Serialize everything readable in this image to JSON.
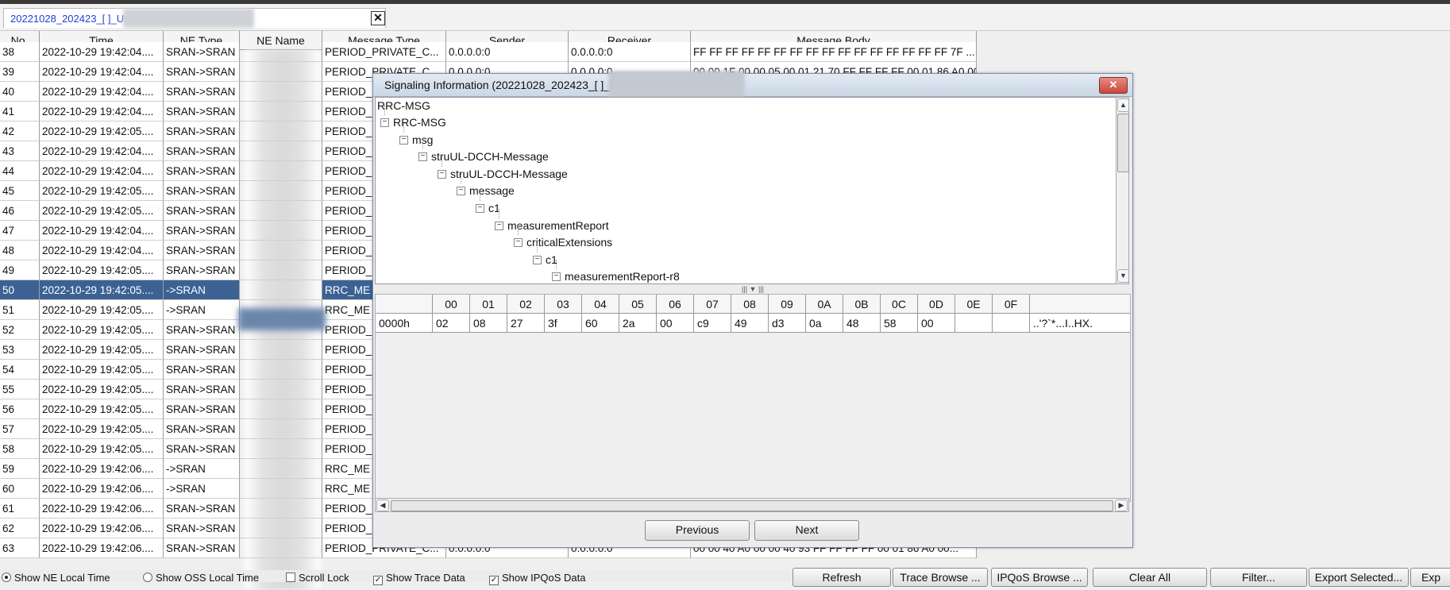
{
  "tab": {
    "title": "20221028_202423_[                          ]_User Trace ID=33333",
    "close_glyph": "✕"
  },
  "table": {
    "columns": [
      "No.",
      "Time",
      "NE Type",
      "NE Name",
      "Message Type",
      "Sender",
      "Receiver",
      "Message Body"
    ],
    "rows": [
      {
        "no": "38",
        "time": "2022-10-29 19:42:04....",
        "ne_type": "SRAN->SRAN",
        "msg": "PERIOD_PRIVATE_C...",
        "sender": "0.0.0.0:0",
        "receiver": "0.0.0.0:0",
        "body": "FF FF FF FF FF FF FF FF FF FF FF FF FF FF FF FF 7F ..."
      },
      {
        "no": "39",
        "time": "2022-10-29 19:42:04....",
        "ne_type": "SRAN->SRAN",
        "msg": "PERIOD_PRIVATE_C...",
        "sender": "0.0.0.0:0",
        "receiver": "0.0.0.0:0",
        "body": "00 00 1F 00 00 05 00 01 21 70 FF FF FF FF 00 01 86 A0 00..."
      },
      {
        "no": "40",
        "time": "2022-10-29 19:42:04....",
        "ne_type": "SRAN->SRAN",
        "msg": "PERIOD_",
        "sender": "",
        "receiver": "",
        "body": ""
      },
      {
        "no": "41",
        "time": "2022-10-29 19:42:04....",
        "ne_type": "SRAN->SRAN",
        "msg": "PERIOD_",
        "sender": "",
        "receiver": "",
        "body": ""
      },
      {
        "no": "42",
        "time": "2022-10-29 19:42:05....",
        "ne_type": "SRAN->SRAN",
        "msg": "PERIOD_",
        "sender": "",
        "receiver": "",
        "body": ""
      },
      {
        "no": "43",
        "time": "2022-10-29 19:42:04....",
        "ne_type": "SRAN->SRAN",
        "msg": "PERIOD_",
        "sender": "",
        "receiver": "",
        "body": ""
      },
      {
        "no": "44",
        "time": "2022-10-29 19:42:04....",
        "ne_type": "SRAN->SRAN",
        "msg": "PERIOD_",
        "sender": "",
        "receiver": "",
        "body": ""
      },
      {
        "no": "45",
        "time": "2022-10-29 19:42:05....",
        "ne_type": "SRAN->SRAN",
        "msg": "PERIOD_",
        "sender": "",
        "receiver": "",
        "body": ""
      },
      {
        "no": "46",
        "time": "2022-10-29 19:42:05....",
        "ne_type": "SRAN->SRAN",
        "msg": "PERIOD_",
        "sender": "",
        "receiver": "",
        "body": ""
      },
      {
        "no": "47",
        "time": "2022-10-29 19:42:04....",
        "ne_type": "SRAN->SRAN",
        "msg": "PERIOD_",
        "sender": "",
        "receiver": "",
        "body": ""
      },
      {
        "no": "48",
        "time": "2022-10-29 19:42:04....",
        "ne_type": "SRAN->SRAN",
        "msg": "PERIOD_",
        "sender": "",
        "receiver": "",
        "body": ""
      },
      {
        "no": "49",
        "time": "2022-10-29 19:42:05....",
        "ne_type": "SRAN->SRAN",
        "msg": "PERIOD_",
        "sender": "",
        "receiver": "",
        "body": ""
      },
      {
        "no": "50",
        "time": "2022-10-29 19:42:05....",
        "ne_type": "->SRAN",
        "msg": "RRC_ME",
        "sender": "",
        "receiver": "",
        "body": ""
      },
      {
        "no": "51",
        "time": "2022-10-29 19:42:05....",
        "ne_type": "->SRAN",
        "msg": "RRC_ME",
        "sender": "",
        "receiver": "",
        "body": ""
      },
      {
        "no": "52",
        "time": "2022-10-29 19:42:05....",
        "ne_type": "SRAN->SRAN",
        "msg": "PERIOD_",
        "sender": "",
        "receiver": "",
        "body": ""
      },
      {
        "no": "53",
        "time": "2022-10-29 19:42:05....",
        "ne_type": "SRAN->SRAN",
        "msg": "PERIOD_",
        "sender": "",
        "receiver": "",
        "body": ""
      },
      {
        "no": "54",
        "time": "2022-10-29 19:42:05....",
        "ne_type": "SRAN->SRAN",
        "msg": "PERIOD_",
        "sender": "",
        "receiver": "",
        "body": ""
      },
      {
        "no": "55",
        "time": "2022-10-29 19:42:05....",
        "ne_type": "SRAN->SRAN",
        "msg": "PERIOD_",
        "sender": "",
        "receiver": "",
        "body": ""
      },
      {
        "no": "56",
        "time": "2022-10-29 19:42:05....",
        "ne_type": "SRAN->SRAN",
        "msg": "PERIOD_",
        "sender": "",
        "receiver": "",
        "body": ""
      },
      {
        "no": "57",
        "time": "2022-10-29 19:42:05....",
        "ne_type": "SRAN->SRAN",
        "msg": "PERIOD_",
        "sender": "",
        "receiver": "",
        "body": ""
      },
      {
        "no": "58",
        "time": "2022-10-29 19:42:05....",
        "ne_type": "SRAN->SRAN",
        "msg": "PERIOD_",
        "sender": "",
        "receiver": "",
        "body": ""
      },
      {
        "no": "59",
        "time": "2022-10-29 19:42:06....",
        "ne_type": "->SRAN",
        "msg": "RRC_ME",
        "sender": "",
        "receiver": "",
        "body": ""
      },
      {
        "no": "60",
        "time": "2022-10-29 19:42:06....",
        "ne_type": "->SRAN",
        "msg": "RRC_ME",
        "sender": "",
        "receiver": "",
        "body": ""
      },
      {
        "no": "61",
        "time": "2022-10-29 19:42:06....",
        "ne_type": "SRAN->SRAN",
        "msg": "PERIOD_",
        "sender": "",
        "receiver": "",
        "body": ""
      },
      {
        "no": "62",
        "time": "2022-10-29 19:42:06....",
        "ne_type": "SRAN->SRAN",
        "msg": "PERIOD_",
        "sender": "",
        "receiver": "",
        "body": ""
      },
      {
        "no": "63",
        "time": "2022-10-29 19:42:06....",
        "ne_type": "SRAN->SRAN",
        "msg": "PERIOD_PRIVATE_C...",
        "sender": "0.0.0.0:0",
        "receiver": "0.0.0.0:0",
        "body": "00 00 40 A0 00 00 40 93 FF FF FF FF 00 01 86 A0 00..."
      }
    ],
    "selected_row": "50",
    "selection_color": "#3c6294"
  },
  "dialog": {
    "title": "Signaling Information (20221028_202423_[                          ]_User Trace ID=33333)",
    "close_glyph": "✕",
    "tree_root": "RRC-MSG",
    "tree": [
      {
        "label": "RRC-MSG",
        "depth": 0
      },
      {
        "label": "msg",
        "depth": 1
      },
      {
        "label": "struUL-DCCH-Message",
        "depth": 2
      },
      {
        "label": "struUL-DCCH-Message",
        "depth": 3
      },
      {
        "label": "message",
        "depth": 4
      },
      {
        "label": "c1",
        "depth": 5
      },
      {
        "label": "measurementReport",
        "depth": 6
      },
      {
        "label": "criticalExtensions",
        "depth": 7
      },
      {
        "label": "c1",
        "depth": 8
      },
      {
        "label": "measurementReport-r8",
        "depth": 9
      }
    ],
    "hex": {
      "headers": [
        "00",
        "01",
        "02",
        "03",
        "04",
        "05",
        "06",
        "07",
        "08",
        "09",
        "0A",
        "0B",
        "0C",
        "0D",
        "0E",
        "0F"
      ],
      "row_offset": "0000h",
      "row_bytes": [
        "02",
        "08",
        "27",
        "3f",
        "60",
        "2a",
        "00",
        "c9",
        "49",
        "d3",
        "0a",
        "48",
        "58",
        "00",
        "",
        ""
      ],
      "row_ascii": "..'?`*...I..HX."
    },
    "prev_label": "Previous",
    "next_label": "Next"
  },
  "status": {
    "options": [
      {
        "label": "Show NE Local Time",
        "kind": "radio",
        "checked": true
      },
      {
        "label": "Show OSS Local Time",
        "kind": "radio",
        "checked": false
      },
      {
        "label": "Scroll Lock",
        "kind": "check",
        "checked": false
      },
      {
        "label": "Show Trace Data",
        "kind": "check",
        "checked": true
      },
      {
        "label": "Show IPQoS Data",
        "kind": "check",
        "checked": true
      }
    ],
    "buttons": [
      "Refresh",
      "Trace Browse ...",
      "IPQoS Browse ...",
      "Clear All",
      "Filter...",
      "Export Selected...",
      "Exp"
    ]
  }
}
